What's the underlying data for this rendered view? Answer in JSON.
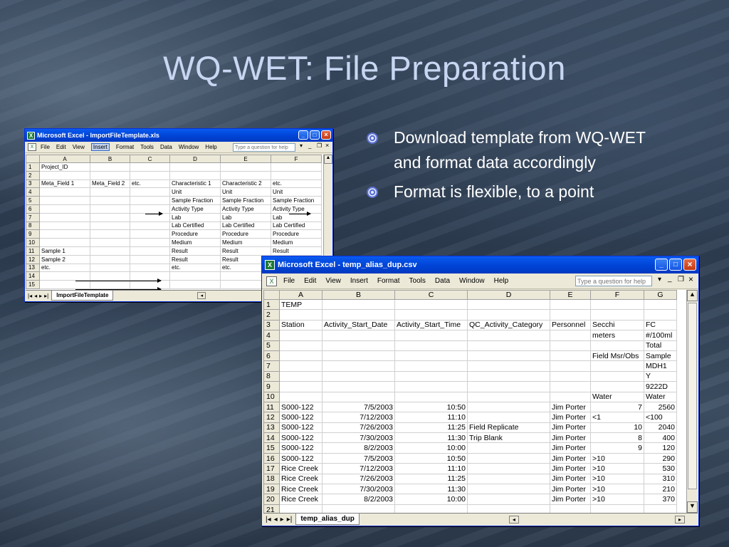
{
  "slide": {
    "title": "WQ-WET:  File Preparation",
    "bullets": [
      "Download template from WQ-WET and format data accordingly",
      "Format is flexible, to a point"
    ]
  },
  "window1": {
    "title": "Microsoft Excel - ImportFileTemplate.xls",
    "menus": [
      "File",
      "Edit",
      "View",
      "Insert",
      "Format",
      "Tools",
      "Data",
      "Window",
      "Help"
    ],
    "help_placeholder": "Type a question for help",
    "columns": [
      "A",
      "B",
      "C",
      "D",
      "E",
      "F"
    ],
    "rows": [
      [
        "1",
        "Project_ID",
        "",
        "",
        "",
        "",
        ""
      ],
      [
        "2",
        "",
        "",
        "",
        "",
        "",
        ""
      ],
      [
        "3",
        "Meta_Field 1",
        "Meta_Field 2",
        "etc.",
        "Characteristic 1",
        "Characteristic 2",
        "etc."
      ],
      [
        "4",
        "",
        "",
        "",
        "Unit",
        "Unit",
        "Unit"
      ],
      [
        "5",
        "",
        "",
        "",
        "Sample Fraction",
        "Sample Fraction",
        "Sample Fraction"
      ],
      [
        "6",
        "",
        "",
        "",
        "Activity Type",
        "Activity Type",
        "Activity Type"
      ],
      [
        "7",
        "",
        "",
        "",
        "Lab",
        "Lab",
        "Lab"
      ],
      [
        "8",
        "",
        "",
        "",
        "Lab Certified",
        "Lab Certified",
        "Lab Certified"
      ],
      [
        "9",
        "",
        "",
        "",
        "Procedure",
        "Procedure",
        "Procedure"
      ],
      [
        "10",
        "",
        "",
        "",
        "Medium",
        "Medium",
        "Medium"
      ],
      [
        "11",
        "Sample 1",
        "",
        "",
        "Result",
        "Result",
        "Result"
      ],
      [
        "12",
        "Sample 2",
        "",
        "",
        "Result",
        "Result",
        "Result"
      ],
      [
        "13",
        "etc.",
        "",
        "",
        "etc.",
        "etc.",
        ""
      ],
      [
        "14",
        "",
        "",
        "",
        "",
        "",
        ""
      ],
      [
        "15",
        "",
        "",
        "",
        "",
        "",
        ""
      ]
    ],
    "sheet_tab": "ImportFileTemplate"
  },
  "window2": {
    "title": "Microsoft Excel - temp_alias_dup.csv",
    "menus": [
      "File",
      "Edit",
      "View",
      "Insert",
      "Format",
      "Tools",
      "Data",
      "Window",
      "Help"
    ],
    "help_placeholder": "Type a question for help",
    "columns": [
      "A",
      "B",
      "C",
      "D",
      "E",
      "F",
      "G"
    ],
    "rows": [
      [
        "1",
        "TEMP",
        "",
        "",
        "",
        "",
        "",
        ""
      ],
      [
        "2",
        "",
        "",
        "",
        "",
        "",
        "",
        ""
      ],
      [
        "3",
        "Station",
        "Activity_Start_Date",
        "Activity_Start_Time",
        "QC_Activity_Category",
        "Personnel",
        "Secchi",
        "FC"
      ],
      [
        "4",
        "",
        "",
        "",
        "",
        "",
        "meters",
        "#/100ml"
      ],
      [
        "5",
        "",
        "",
        "",
        "",
        "",
        "",
        "Total"
      ],
      [
        "6",
        "",
        "",
        "",
        "",
        "",
        "Field Msr/Obs",
        "Sample"
      ],
      [
        "7",
        "",
        "",
        "",
        "",
        "",
        "",
        "MDH1"
      ],
      [
        "8",
        "",
        "",
        "",
        "",
        "",
        "",
        "Y"
      ],
      [
        "9",
        "",
        "",
        "",
        "",
        "",
        "",
        "9222D"
      ],
      [
        "10",
        "",
        "",
        "",
        "",
        "",
        "Water",
        "Water"
      ],
      [
        "11",
        "S000-122",
        "7/5/2003",
        "10:50",
        "",
        "Jim Porter",
        "7",
        "2560"
      ],
      [
        "12",
        "S000-122",
        "7/12/2003",
        "11:10",
        "",
        "Jim Porter",
        "<1",
        "<100"
      ],
      [
        "13",
        "S000-122",
        "7/26/2003",
        "11:25",
        "Field Replicate",
        "Jim Porter",
        "10",
        "2040"
      ],
      [
        "14",
        "S000-122",
        "7/30/2003",
        "11:30",
        "Trip Blank",
        "Jim Porter",
        "8",
        "400"
      ],
      [
        "15",
        "S000-122",
        "8/2/2003",
        "10:00",
        "",
        "Jim Porter",
        "9",
        "120"
      ],
      [
        "16",
        "S000-122",
        "7/5/2003",
        "10:50",
        "",
        "Jim Porter",
        ">10",
        "290"
      ],
      [
        "17",
        "Rice Creek",
        "7/12/2003",
        "11:10",
        "",
        "Jim Porter",
        ">10",
        "530"
      ],
      [
        "18",
        "Rice Creek",
        "7/26/2003",
        "11:25",
        "",
        "Jim Porter",
        ">10",
        "310"
      ],
      [
        "19",
        "Rice Creek",
        "7/30/2003",
        "11:30",
        "",
        "Jim Porter",
        ">10",
        "210"
      ],
      [
        "20",
        "Rice Creek",
        "8/2/2003",
        "10:00",
        "",
        "Jim Porter",
        ">10",
        "370"
      ],
      [
        "21",
        "",
        "",
        "",
        "",
        "",
        "",
        ""
      ]
    ],
    "sheet_tab": "temp_alias_dup"
  },
  "colors": {
    "title_text": "#c9d6f2",
    "titlebar_blue": "#0a5bf0",
    "excel_green": "#1d7a33"
  }
}
